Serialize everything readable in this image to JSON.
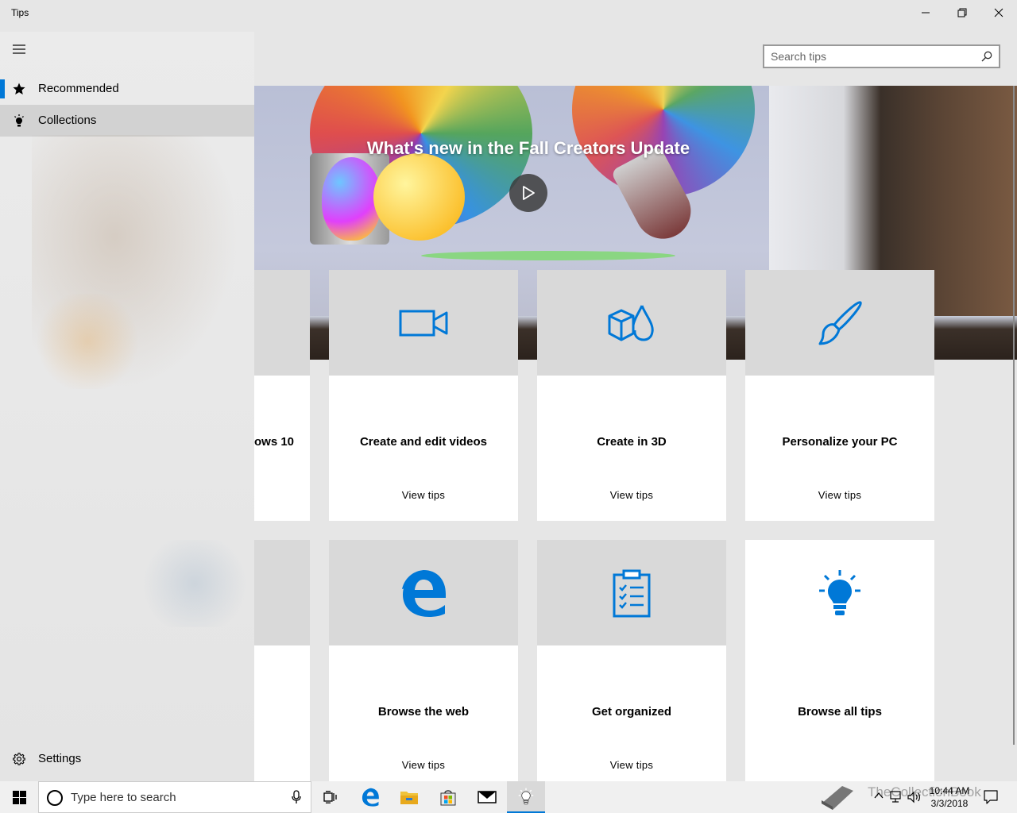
{
  "window": {
    "title": "Tips"
  },
  "search": {
    "placeholder": "Search tips"
  },
  "hero": {
    "headline": "What's new in the Fall Creators Update"
  },
  "nav": {
    "items": [
      {
        "label": "Recommended"
      },
      {
        "label": "Collections"
      }
    ],
    "settings_label": "Settings"
  },
  "cards": [
    {
      "title": "ows 10",
      "link": ""
    },
    {
      "title": "Create and edit videos",
      "link": "View tips",
      "icon": "video-camera-icon"
    },
    {
      "title": "Create in 3D",
      "link": "View tips",
      "icon": "3d-shapes-icon"
    },
    {
      "title": "Personalize your PC",
      "link": "View tips",
      "icon": "paintbrush-icon"
    },
    {
      "title": "",
      "link": ""
    },
    {
      "title": "Browse the web",
      "link": "View tips",
      "icon": "edge-icon"
    },
    {
      "title": "Get organized",
      "link": "View tips",
      "icon": "clipboard-icon"
    },
    {
      "title": "Browse all tips",
      "link": "",
      "icon": "lightbulb-icon"
    }
  ],
  "taskbar": {
    "search_placeholder": "Type here to search",
    "time": "10:44 AM",
    "date": "3/3/2018",
    "watermark": "TheCollectionBook"
  },
  "colors": {
    "accent": "#0078d7",
    "nav_bg": "#e6e6e6",
    "card_band": "#d9d9d9"
  }
}
